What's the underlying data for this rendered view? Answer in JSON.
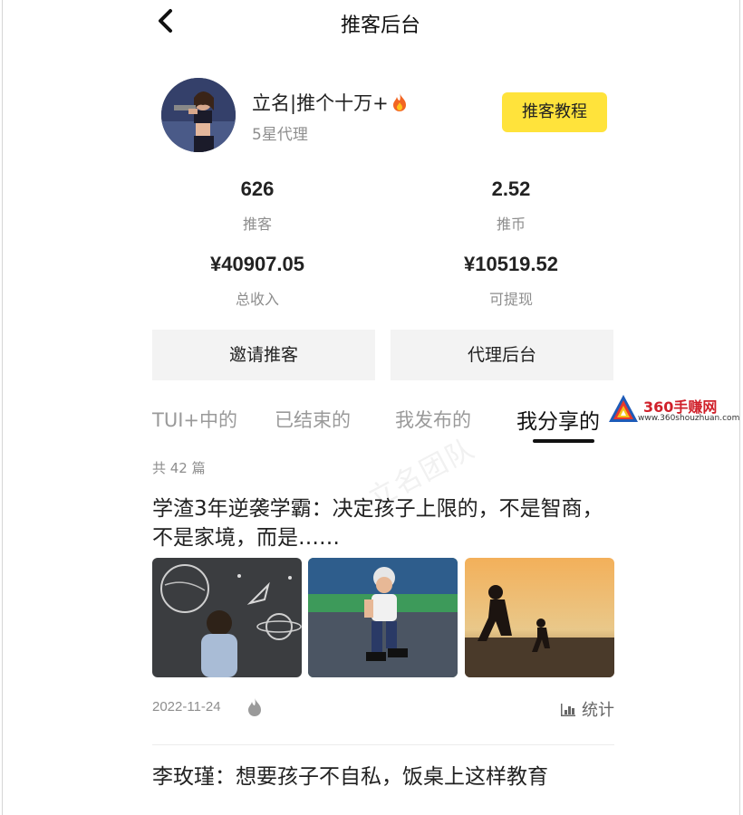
{
  "header": {
    "title": "推客后台"
  },
  "profile": {
    "name": "立名|推个十万+",
    "level": "5星代理",
    "tutorial_label": "推客教程"
  },
  "stats": [
    {
      "value": "626",
      "label": "推客"
    },
    {
      "value": "2.52",
      "label": "推币"
    },
    {
      "value": "¥40907.05",
      "label": "总收入"
    },
    {
      "value": "¥10519.52",
      "label": "可提现"
    }
  ],
  "actions": {
    "invite_label": "邀请推客",
    "agent_label": "代理后台"
  },
  "tabs": [
    {
      "label": "TUI+中的"
    },
    {
      "label": "已结束的"
    },
    {
      "label": "我发布的"
    },
    {
      "label": "我分享的",
      "active": true
    }
  ],
  "watermark": {
    "brand": "360手赚网",
    "url": "www.360shouzhuan.com",
    "faint": "立名团队"
  },
  "list": {
    "count_label": "共 42 篇",
    "articles": [
      {
        "title": "学渣3年逆袭学霸：决定孩子上限的，不是智商，不是家境，而是……",
        "date": "2022-11-24",
        "stats_label": "统计"
      },
      {
        "title": "李玫瑾：想要孩子不自私，饭桌上这样教育"
      }
    ]
  },
  "colors": {
    "accent_yellow": "#ffe33b",
    "text_gray": "#8e8e8e",
    "button_bg": "#f3f3f3"
  },
  "icons": [
    "back-arrow-icon",
    "fire-emoji-icon",
    "flame-icon",
    "bar-chart-icon"
  ]
}
